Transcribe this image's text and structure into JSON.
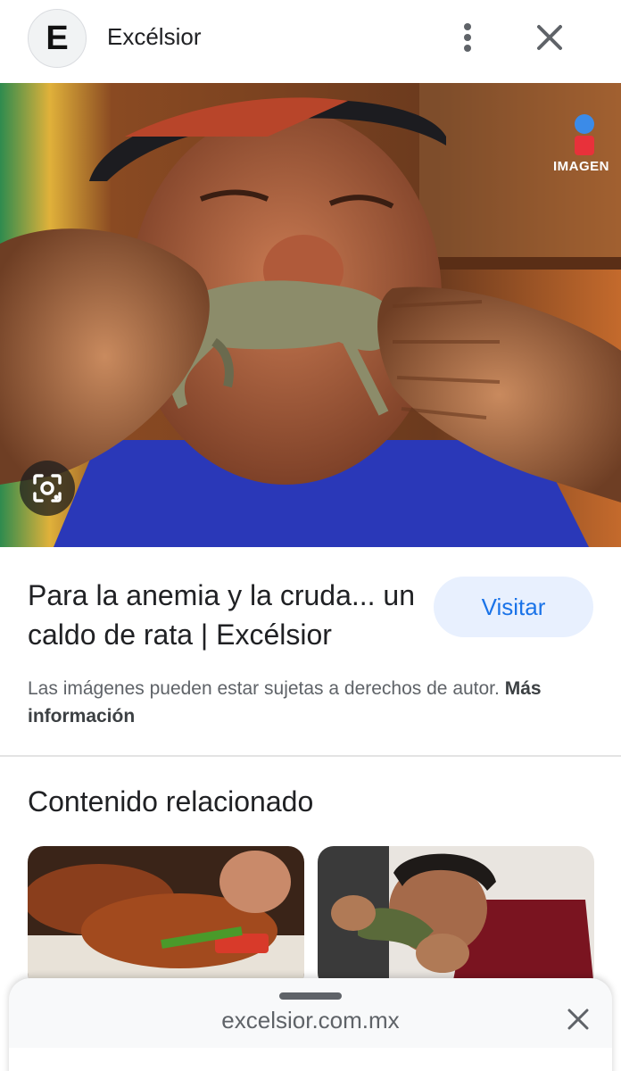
{
  "header": {
    "logo_letter": "E",
    "site_name": "Excélsior",
    "icons": {
      "menu": "more-vert-icon",
      "close": "close-icon"
    }
  },
  "hero": {
    "watermark": "IMAGEN",
    "lens_icon": "google-lens-icon"
  },
  "result": {
    "title": "Para la anemia y la cruda... un caldo de rata | Excélsior",
    "visit_label": "Visitar",
    "copyright_text": "Las imágenes pueden estar sujetas a derechos de autor.",
    "more_info_label": "Más información"
  },
  "related": {
    "heading": "Contenido relacionado"
  },
  "url_sheet": {
    "url": "excelsior.com.mx",
    "close_icon": "close-icon"
  },
  "colors": {
    "accent": "#1a73e8",
    "visit_bg": "#e8f0fe",
    "text": "#202124",
    "muted": "#5f6368"
  }
}
